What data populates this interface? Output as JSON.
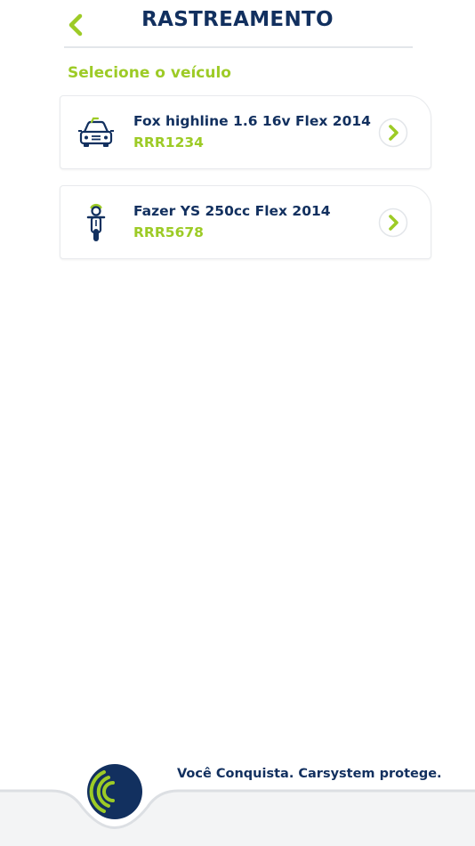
{
  "header": {
    "title": "RASTREAMENTO",
    "back_icon": "chevron-left-icon"
  },
  "section_label": "Selecione o veículo",
  "vehicles": [
    {
      "name": "Fox highline 1.6 16v Flex 2014",
      "plate": "RRR1234",
      "icon": "car-icon"
    },
    {
      "name": "Fazer YS 250cc Flex 2014",
      "plate": "RRR5678",
      "icon": "motorcycle-icon"
    }
  ],
  "footer": {
    "slogan": "Você Conquista. Carsystem protege.",
    "logo_icon": "carsystem-signal-logo"
  },
  "colors": {
    "primary": "#12305f",
    "accent": "#9dcb26",
    "divider": "#e3e6ea"
  }
}
